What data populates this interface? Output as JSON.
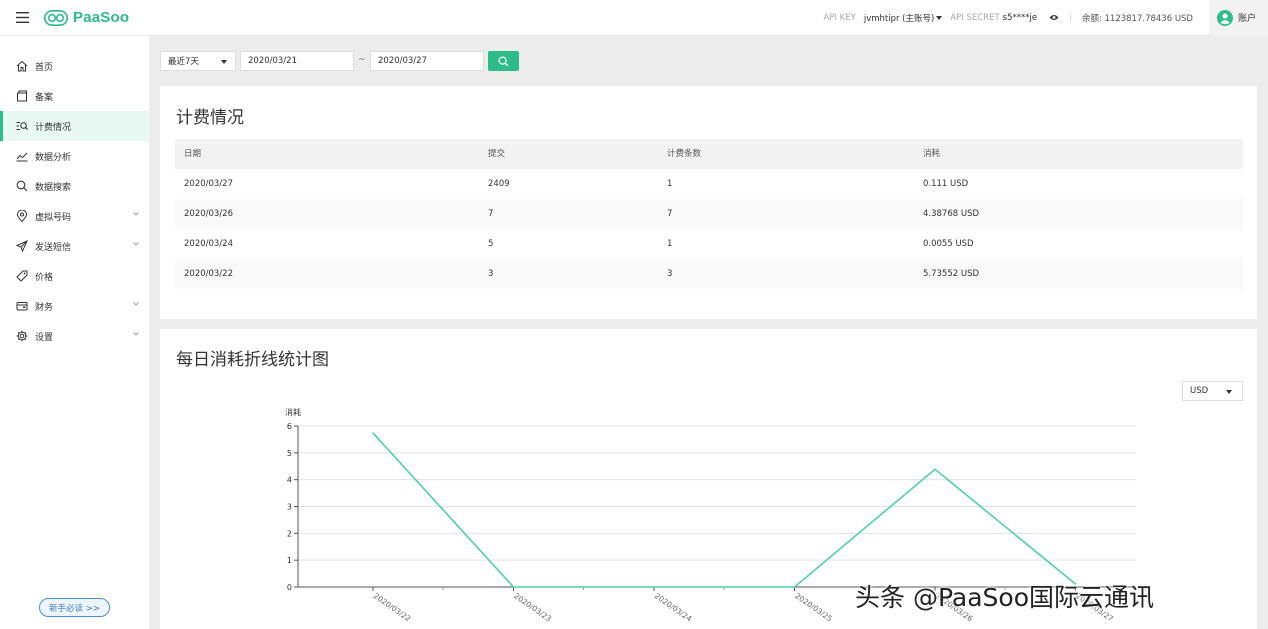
{
  "header": {
    "logo_text": "PaaSoo",
    "api_key_label": "API KEY",
    "api_key_value": "jvmhtipr (主账号)",
    "api_secret_label": "API SECRET",
    "api_secret_value": "s5****je",
    "separator": "|",
    "balance": "余额: 1123817.78436 USD",
    "account_label": "账户"
  },
  "sidebar": {
    "items": [
      {
        "label": "首页",
        "icon": "home-icon"
      },
      {
        "label": "备案",
        "icon": "file-icon"
      },
      {
        "label": "计费情况",
        "icon": "list-search-icon"
      },
      {
        "label": "数据分析",
        "icon": "chart-line-icon"
      },
      {
        "label": "数据搜索",
        "icon": "search-icon"
      },
      {
        "label": "虚拟号码",
        "icon": "location-pin-icon"
      },
      {
        "label": "发送短信",
        "icon": "send-icon"
      },
      {
        "label": "价格",
        "icon": "tag-icon"
      },
      {
        "label": "财务",
        "icon": "wallet-icon"
      },
      {
        "label": "设置",
        "icon": "gear-icon"
      }
    ],
    "guide_button": "新手必读 >>"
  },
  "filters": {
    "range": "最近7天",
    "start_date": "2020/03/21",
    "tilde": "~",
    "end_date": "2020/03/27"
  },
  "billing": {
    "title": "计费情况",
    "columns": [
      "日期",
      "提交",
      "计费条数",
      "消耗"
    ],
    "rows": [
      [
        "2020/03/27",
        "2409",
        "1",
        "0.111 USD"
      ],
      [
        "2020/03/26",
        "7",
        "7",
        "4.38768 USD"
      ],
      [
        "2020/03/24",
        "5",
        "1",
        "0.0055 USD"
      ],
      [
        "2020/03/22",
        "3",
        "3",
        "5.73552 USD"
      ]
    ]
  },
  "chart_section": {
    "title": "每日消耗折线统计图",
    "currency": "USD"
  },
  "chart_data": {
    "type": "line",
    "ylabel": "消耗",
    "ylim": [
      0,
      6
    ],
    "yticks": [
      "0",
      "1",
      "2",
      "3",
      "4",
      "5",
      "6"
    ],
    "x": [
      "2020/03/22",
      "2020/03/23",
      "2020/03/24",
      "2020/03/25",
      "2020/03/26",
      "2020/03/27"
    ],
    "series": [
      {
        "values": [
          5.73552,
          0,
          0,
          0,
          4.38768,
          0.111
        ]
      }
    ],
    "grid": true,
    "line_color": "#4fd1a5"
  },
  "watermark": "头条 @PaaSoo国际云通讯"
}
